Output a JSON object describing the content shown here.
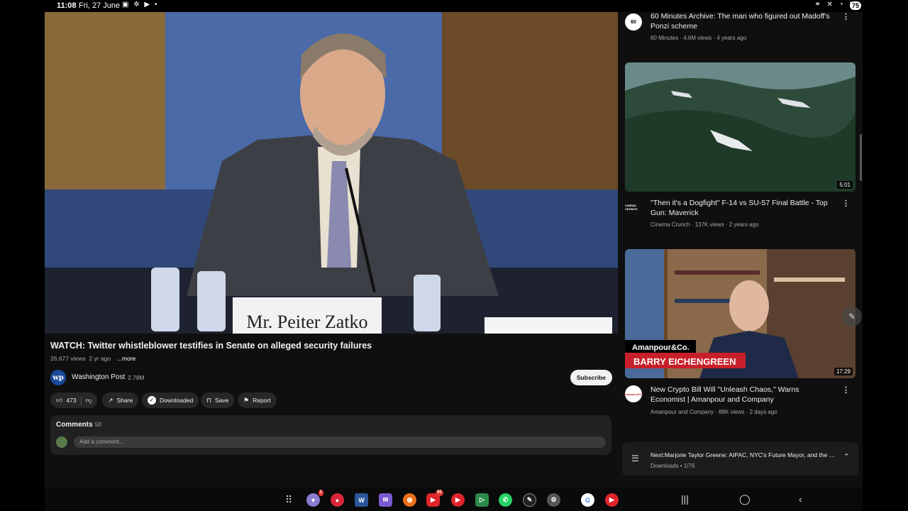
{
  "status_bar": {
    "time": "11:08",
    "date": "Fri, 27 June",
    "left_icons": "▣ ✲ ▶ •",
    "right_icons": "⚭ ✕ ◔ ▮",
    "battery": "75"
  },
  "video": {
    "nameplate": "Mr. Peiter Zatko",
    "title": "WATCH: Twitter whistleblower testifies in Senate on alleged security failures",
    "views": "26,677 views",
    "age": "2 yr ago",
    "more_label": "...more"
  },
  "channel": {
    "avatar_text": "wp",
    "name": "Washington Post",
    "subscribers": "2.78M",
    "subscribe_label": "Subscribe"
  },
  "actions": {
    "like_count": "473",
    "share_label": "Share",
    "downloaded_label": "Downloaded",
    "save_label": "Save",
    "report_label": "Report"
  },
  "comments": {
    "label": "Comments",
    "count": "50",
    "placeholder": "Add a comment..."
  },
  "related": [
    {
      "channel_avatar_text": "60",
      "title": "60 Minutes Archive: The man who figured out Madoff's Ponzi scheme",
      "meta": "60 Minutes · 4.6M views · 4 years ago"
    },
    {
      "duration": "5:01",
      "channel_avatar_text": "CINEMA CRUNCH",
      "title": "\"Then it's a Dogfight\" F-14 vs SU-57 Final Battle - Top Gun: Maverick",
      "meta": "Cinema Crunch · 137K views · 2 years ago"
    },
    {
      "duration": "17:29",
      "thumb_brand": "Amanpour&Co.",
      "thumb_banner": "BARRY EICHENGREEN",
      "channel_avatar_text": "Amanpour&Co.",
      "title": "New Crypto Bill Will \"Unleash Chaos,\" Warns Economist | Amanpour and Company",
      "meta": "Amanpour and Company · 88K views · 2 days ago"
    }
  ],
  "next_up": {
    "title": "Next:Marjorie Taylor Greene: AIPAC, NYC's Future Mayor, and the War...",
    "subtitle": "Downloads • 1/76"
  },
  "taskbar": {
    "badges": {
      "vpn": "1",
      "youtube": "91"
    }
  },
  "colors": {
    "background": "#0f0f0f",
    "accent_red": "#cc1f2d",
    "text_primary": "#f1f1f1",
    "text_secondary": "#aaaaaa"
  }
}
